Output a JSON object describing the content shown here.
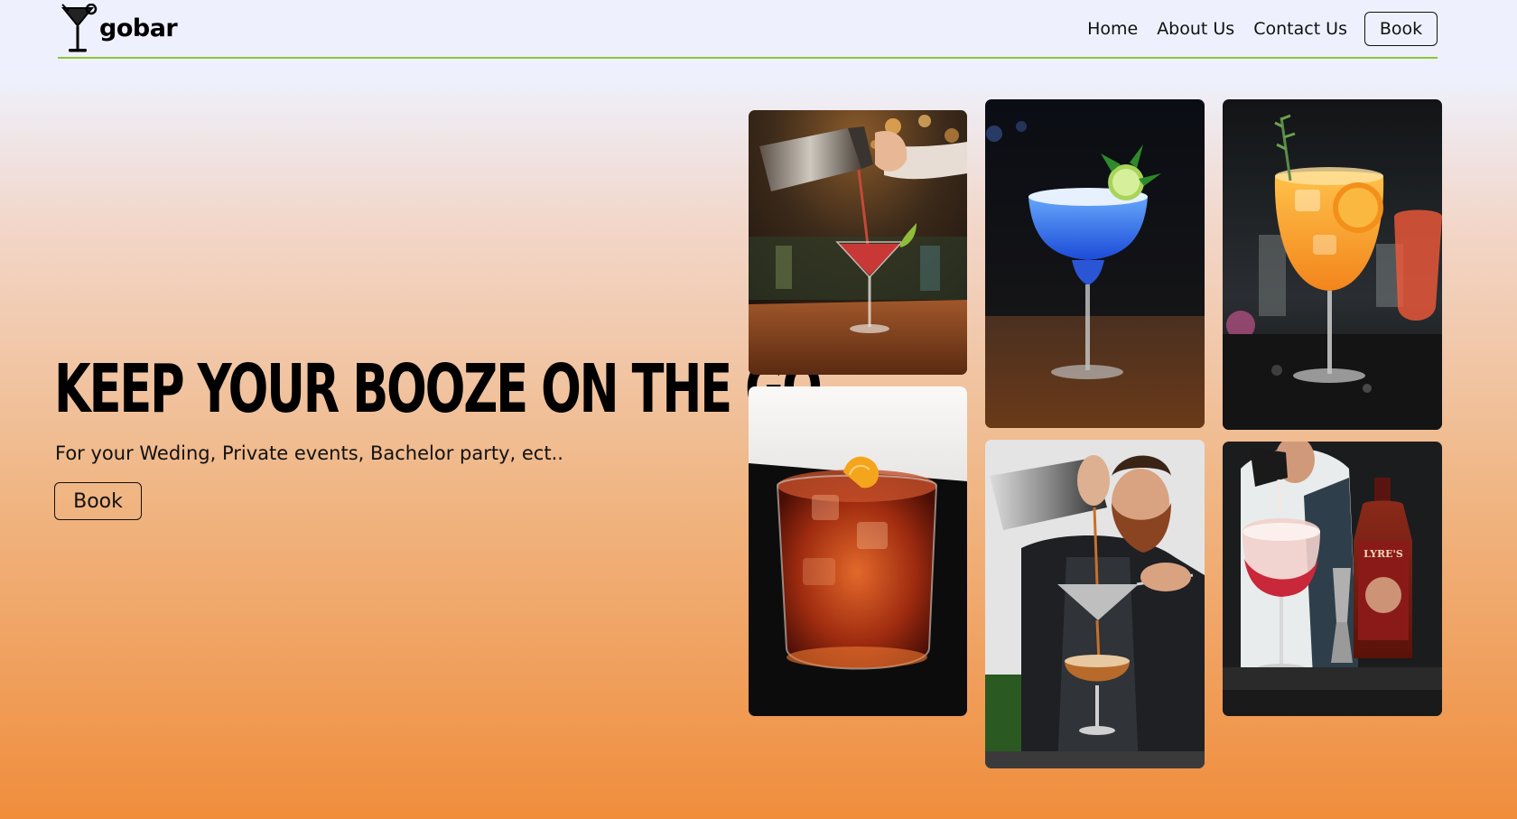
{
  "nav": {
    "logo_text": "gobar",
    "links": [
      "Home",
      "About Us",
      "Contact Us"
    ],
    "book_label": "Book"
  },
  "hero": {
    "title": "KEEP YOUR BOOZE ON THE GO",
    "subtitle": "For your Weding, Private events, Bachelor party, ect..",
    "book_label": "Book"
  },
  "colors": {
    "background_top": "#eef1fd",
    "background_bottom": "#f08d3c",
    "nav_underline": "#8fc43a",
    "text": "#111111"
  },
  "gallery": {
    "images": [
      "bartender-shaker-martini-photo",
      "blue-margarita-photo",
      "orange-spritz-photo",
      "negroni-rocks-photo",
      "bartender-straining-cocktail-photo",
      "rose-wine-pour-photo"
    ],
    "bottle_label": "LYRE'S"
  }
}
